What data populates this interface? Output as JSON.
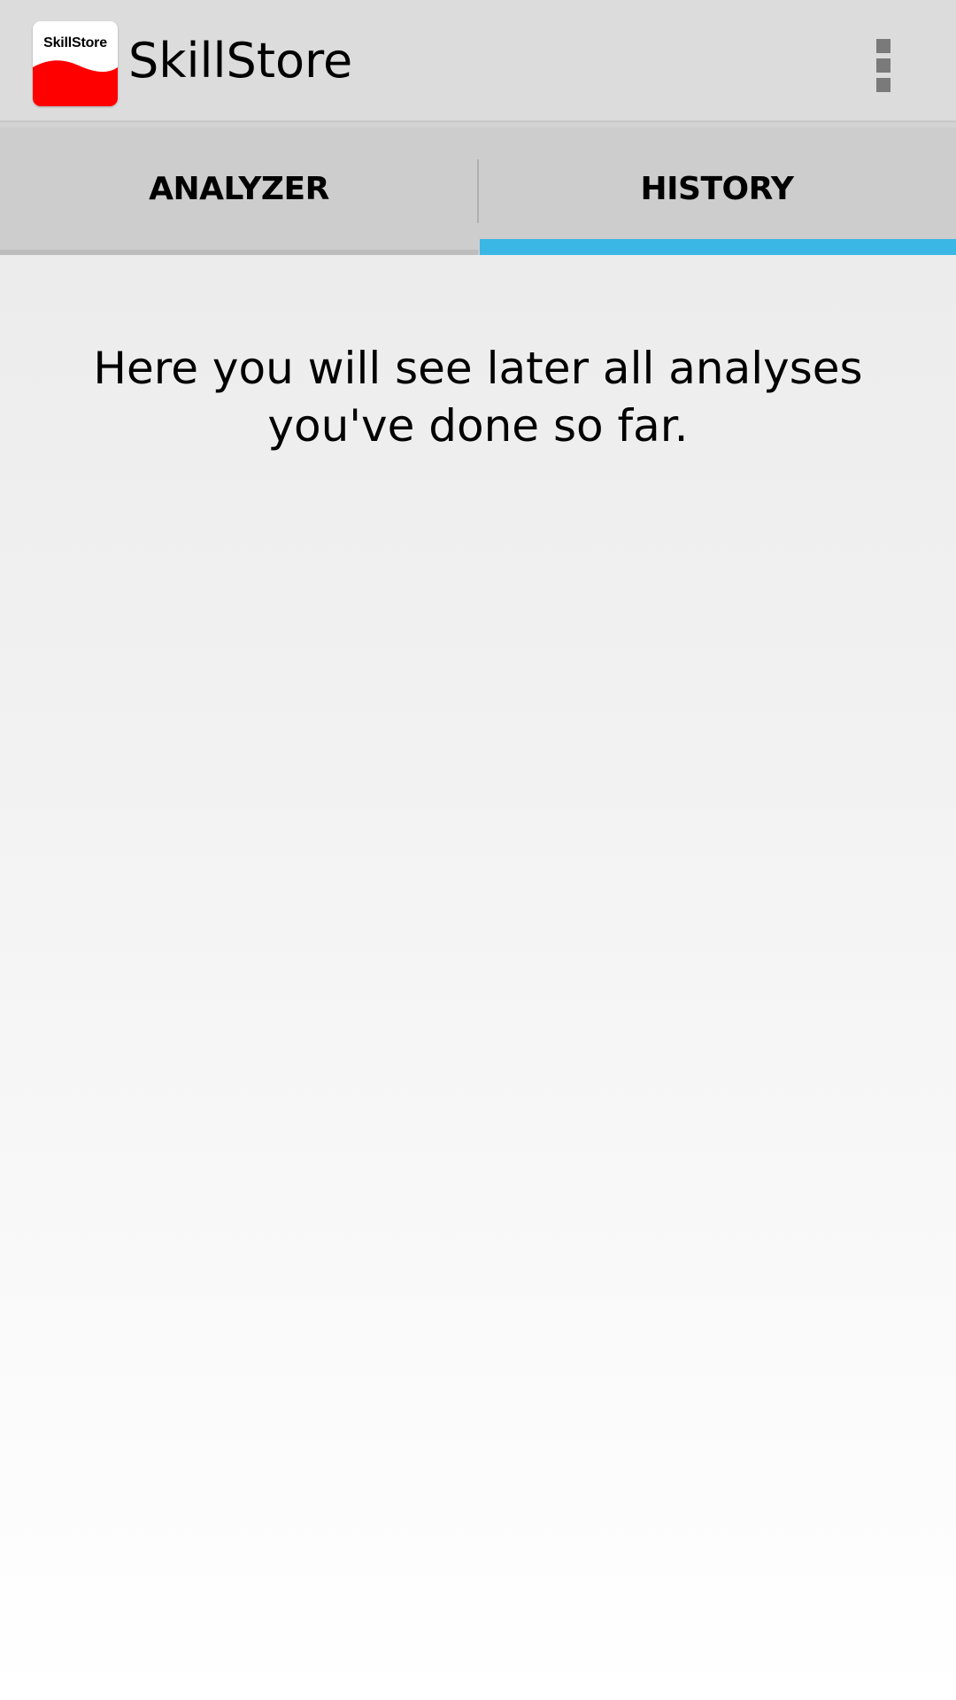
{
  "app": {
    "title": "SkillStore",
    "icon_text": "SkillStore",
    "icon_colors": {
      "background": "#ffffff",
      "wave": "#ff0000"
    }
  },
  "action_bar": {
    "overflow_icon": "overflow-menu-icon"
  },
  "tabs": [
    {
      "label": "ANALYZER",
      "selected": false
    },
    {
      "label": "HISTORY",
      "selected": true
    }
  ],
  "colors": {
    "tab_indicator": "#3bb7e6",
    "action_bar": "#dcdcdc",
    "tab_bar": "#cdcdcd"
  },
  "history": {
    "empty_message": "Here you will see later all analyses you've done so far."
  }
}
